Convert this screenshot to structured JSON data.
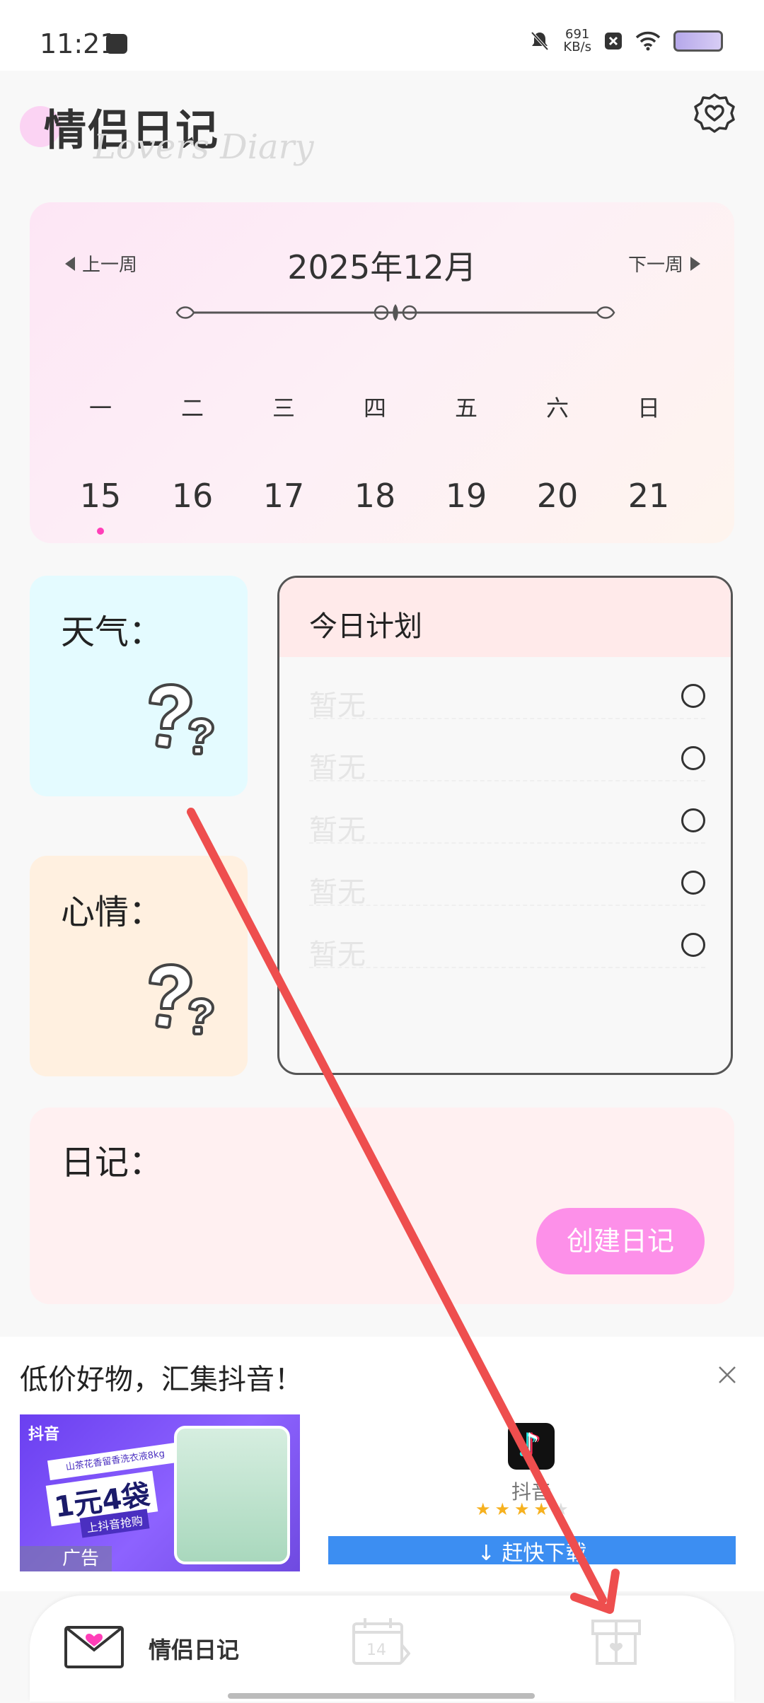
{
  "status_bar": {
    "time": "11:21",
    "speed_value": "691",
    "speed_unit": "KB/s"
  },
  "header": {
    "title": "情侣日记",
    "subtitle": "Lovers Diary",
    "settings_icon": "heart-gear-icon"
  },
  "calendar": {
    "prev_label": "上一周",
    "next_label": "下一周",
    "month_title": "2025年12月",
    "weekdays": [
      "一",
      "二",
      "三",
      "四",
      "五",
      "六",
      "日"
    ],
    "dates": [
      "15",
      "16",
      "17",
      "18",
      "19",
      "20",
      "21"
    ],
    "today_index": 0,
    "today_dot_color": "#ff3fb8"
  },
  "weather": {
    "label": "天气："
  },
  "mood": {
    "label": "心情："
  },
  "plan": {
    "title": "今日计划",
    "items": [
      "暂无",
      "暂无",
      "暂无",
      "暂无",
      "暂无"
    ]
  },
  "diary": {
    "label": "日记：",
    "create_button": "创建日记",
    "button_color": "#fd90e9"
  },
  "ad": {
    "title": "低价好物，汇集抖音！",
    "image_brand": "抖音",
    "image_banner": "山茶花香留香洗衣液8kg",
    "image_headline": "1元4袋",
    "image_sub": "上抖音抢购",
    "ad_tag": "广告",
    "app_name": "抖音",
    "rating": 4,
    "download_label": "↓ 赶快下载"
  },
  "bottom_nav": {
    "items": [
      {
        "icon": "envelope-heart-icon",
        "label": "情侣日记",
        "active": true
      },
      {
        "icon": "calendar-14-icon",
        "label": ""
      },
      {
        "icon": "gift-box-icon",
        "label": ""
      }
    ]
  },
  "colors": {
    "annotation_arrow": "#ee4e4e"
  }
}
